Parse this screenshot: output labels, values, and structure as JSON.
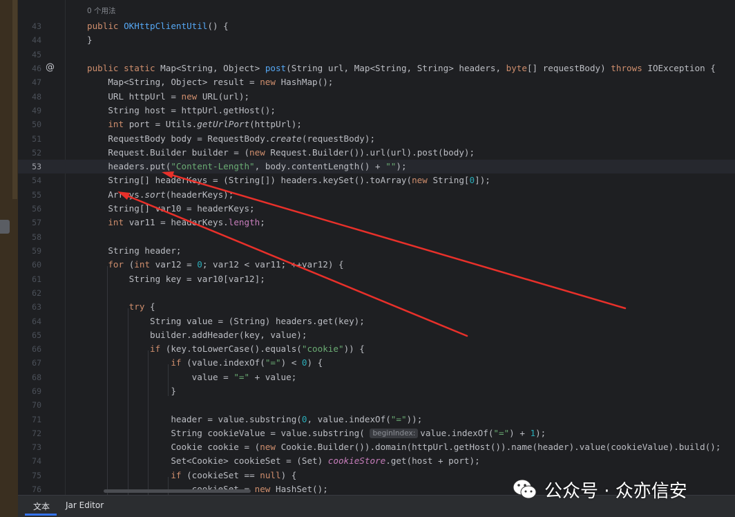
{
  "editor": {
    "usage_hint": "0 个用法",
    "current_line": "53",
    "line_numbers": [
      "43",
      "44",
      "45",
      "46",
      "47",
      "48",
      "49",
      "50",
      "51",
      "52",
      "53",
      "54",
      "55",
      "56",
      "57",
      "58",
      "59",
      "60",
      "61",
      "62",
      "63",
      "64",
      "65",
      "66",
      "67",
      "68",
      "69",
      "70",
      "71",
      "72",
      "73",
      "74",
      "75",
      "76"
    ],
    "inlay_hint": "beginIndex:"
  },
  "tabs": [
    {
      "label": "文本",
      "active": true
    },
    {
      "label": "Jar Editor",
      "active": false
    }
  ],
  "watermark": {
    "text": "公众号 · 众亦信安",
    "icon": "wechat-icon"
  },
  "annotations": {
    "arrow_color": "#e8302a",
    "count": 2
  },
  "colors": {
    "background": "#1e1f22",
    "keyword": "#cf8e6d",
    "method": "#56a8f5",
    "string": "#6aab73",
    "number": "#2aacb8",
    "text": "#bcbec4"
  }
}
